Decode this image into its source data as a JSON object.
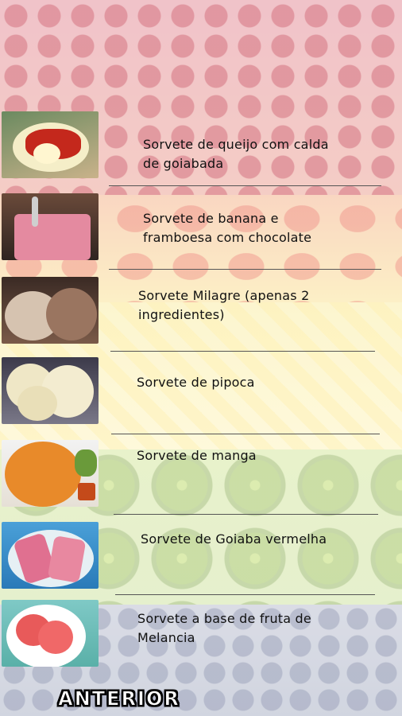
{
  "recipes": [
    {
      "title_line1": "Sorvete de queijo com calda",
      "title_line2": "de goiabada",
      "thumb": "cheese-ice-cream-guava-syrup"
    },
    {
      "title_line1": "Sorvete de banana e",
      "title_line2": "framboesa com chocolate",
      "thumb": "banana-raspberry-ice-cream"
    },
    {
      "title_line1": "Sorvete Milagre (apenas 2",
      "title_line2": "ingredientes)",
      "thumb": "miracle-ice-cream"
    },
    {
      "title_line1": "Sorvete de pipoca",
      "title_line2": "",
      "thumb": "popcorn-ice-cream"
    },
    {
      "title_line1": "Sorvete de manga",
      "title_line2": "",
      "thumb": "mango-ice-cream"
    },
    {
      "title_line1": "Sorvete de Goiaba vermelha",
      "title_line2": "",
      "thumb": "red-guava-popsicle"
    },
    {
      "title_line1": "Sorvete a base de fruta de",
      "title_line2": "Melancia",
      "thumb": "watermelon-ice-cream"
    }
  ],
  "footer": {
    "back_label": "ANTERIOR"
  }
}
